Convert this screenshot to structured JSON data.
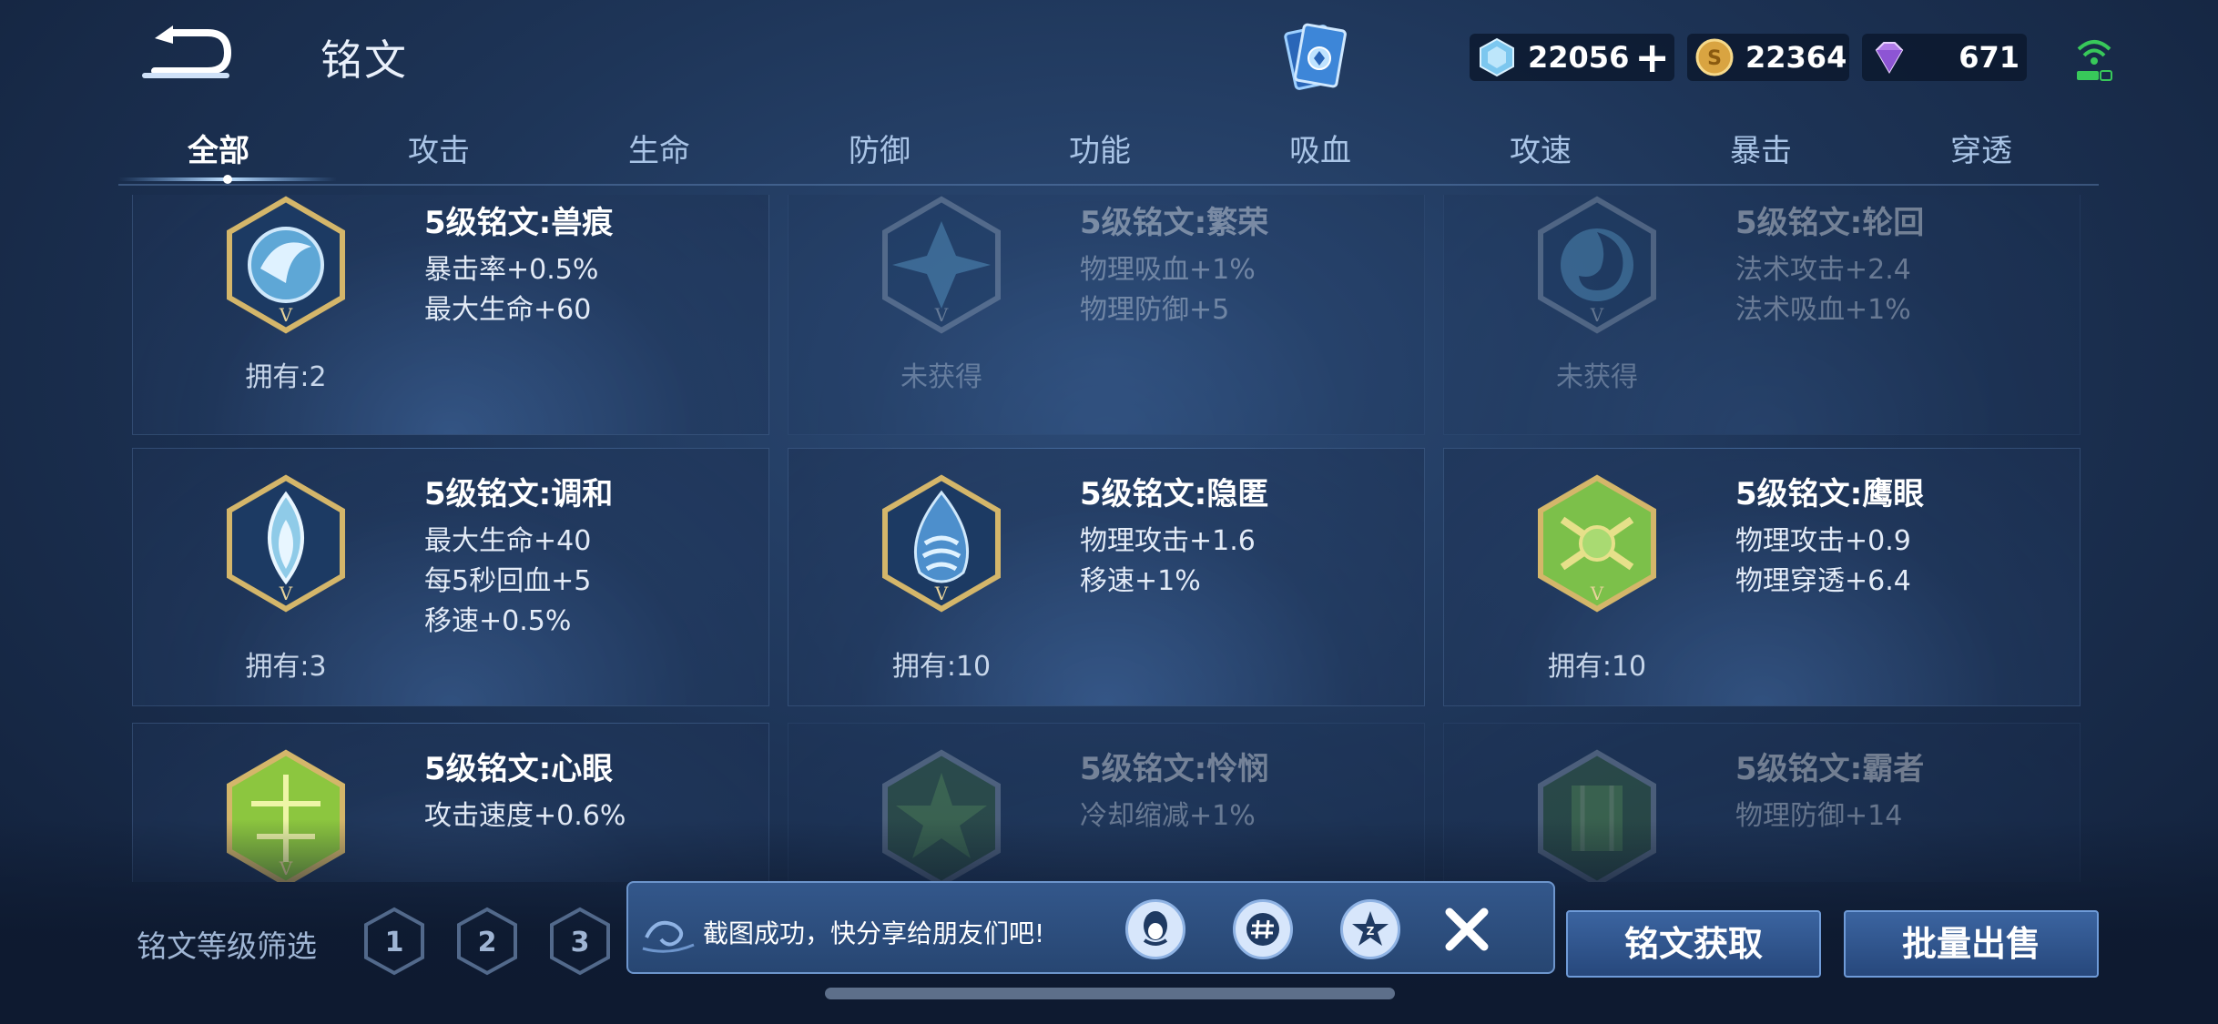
{
  "header": {
    "title": "铭文",
    "currencies": [
      {
        "icon": "diamond-icon",
        "value": "22056"
      },
      {
        "icon": "gold-coin-icon",
        "value": "22364"
      },
      {
        "icon": "purple-gem-icon",
        "value": "671"
      }
    ]
  },
  "tabs": [
    {
      "label": "全部",
      "active": true
    },
    {
      "label": "攻击"
    },
    {
      "label": "生命"
    },
    {
      "label": "防御"
    },
    {
      "label": "功能"
    },
    {
      "label": "吸血"
    },
    {
      "label": "攻速"
    },
    {
      "label": "暴击"
    },
    {
      "label": "穿透"
    }
  ],
  "runes": [
    {
      "name": "5级铭文:兽痕",
      "stats": [
        "暴击率+0.5%",
        "最大生命+60"
      ],
      "owned": "拥有:2",
      "locked": false,
      "color": "#5ea7d6"
    },
    {
      "name": "5级铭文:繁荣",
      "stats": [
        "物理吸血+1%",
        "物理防御+5"
      ],
      "owned": "未获得",
      "locked": true,
      "color": "#5ea7d6"
    },
    {
      "name": "5级铭文:轮回",
      "stats": [
        "法术攻击+2.4",
        "法术吸血+1%"
      ],
      "owned": "未获得",
      "locked": true,
      "color": "#5ea7d6"
    },
    {
      "name": "5级铭文:调和",
      "stats": [
        "最大生命+40",
        "每5秒回血+5",
        "移速+0.5%"
      ],
      "owned": "拥有:3",
      "locked": false,
      "color": "#8fcbe8"
    },
    {
      "name": "5级铭文:隐匿",
      "stats": [
        "物理攻击+1.6",
        "移速+1%"
      ],
      "owned": "拥有:10",
      "locked": false,
      "color": "#4d8fcc"
    },
    {
      "name": "5级铭文:鹰眼",
      "stats": [
        "物理攻击+0.9",
        "物理穿透+6.4"
      ],
      "owned": "拥有:10",
      "locked": false,
      "color": "#7cc04a"
    },
    {
      "name": "5级铭文:心眼",
      "stats": [
        "攻击速度+0.6%"
      ],
      "owned": "",
      "locked": false,
      "color": "#8cc63f"
    },
    {
      "name": "5级铭文:怜悯",
      "stats": [
        "冷却缩减+1%"
      ],
      "owned": "",
      "locked": true,
      "color": "#6ab04c"
    },
    {
      "name": "5级铭文:霸者",
      "stats": [
        "物理防御+14"
      ],
      "owned": "",
      "locked": true,
      "color": "#6ab04c"
    }
  ],
  "filter": {
    "label": "铭文等级筛选",
    "levels": [
      "1",
      "2",
      "3"
    ]
  },
  "toast": {
    "message": "截图成功，快分享给朋友们吧!",
    "share_targets": [
      "qq-icon",
      "hashtag-icon",
      "qzone-star-icon"
    ]
  },
  "buttons": {
    "obtain": "铭文获取",
    "sell": "批量出售"
  }
}
